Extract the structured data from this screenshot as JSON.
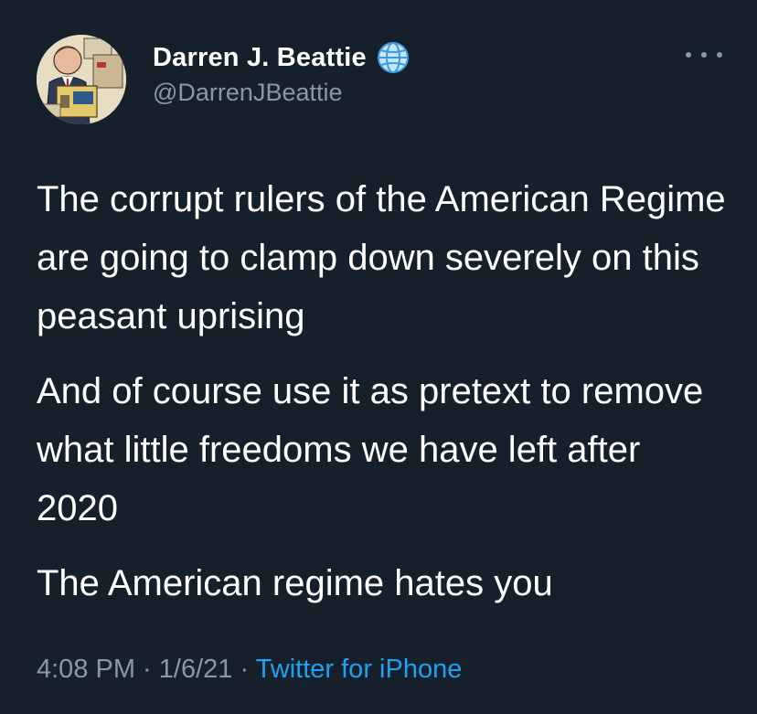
{
  "author": {
    "display_name": "Darren J. Beattie",
    "handle": "@DarrenJBeattie",
    "avatar_icon": "caricature-reading-book-avatar",
    "badge_icon": "globe-icon"
  },
  "menu": {
    "more_icon": "more-horizontal-icon"
  },
  "tweet": {
    "paragraphs": [
      "The corrupt rulers of the American Regime are going to clamp down severely on this peasant uprising",
      "And of course use it as pretext to remove what little freedoms we have left after 2020",
      "The American regime hates you"
    ],
    "time": "4:08 PM",
    "separator": " · ",
    "date": "1/6/21",
    "source": "Twitter for iPhone"
  },
  "colors": {
    "background": "#15202b",
    "text": "#ffffff",
    "secondary": "#8899a6",
    "accent": "#1da1f2"
  }
}
